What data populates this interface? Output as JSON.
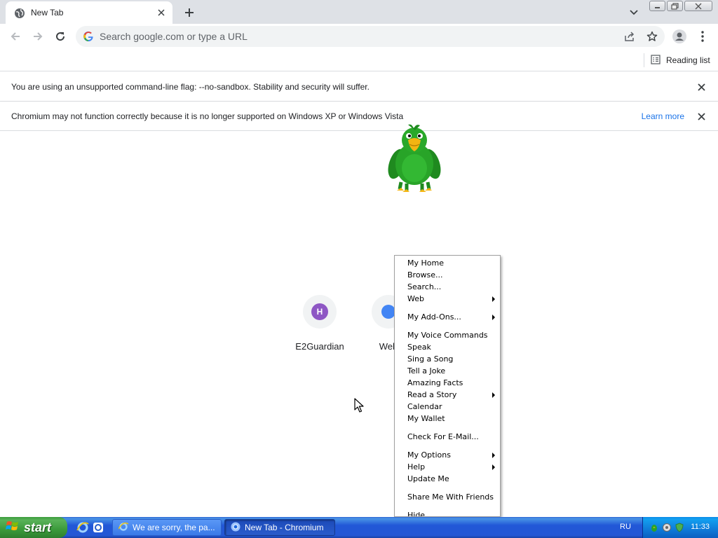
{
  "browser": {
    "tab": {
      "title": "New Tab",
      "close_glyph": "×"
    },
    "newtab_glyph": "+",
    "omnibox": {
      "placeholder": "Search google.com or type a URL"
    },
    "bookmarks": {
      "reading_list": "Reading list"
    },
    "infobars": [
      {
        "message": "You are using an unsupported command-line flag: --no-sandbox. Stability and security will suffer."
      },
      {
        "message": "Chromium may not function correctly because it is no longer supported on Windows XP or Windows Vista",
        "link": "Learn more"
      }
    ],
    "icons": {
      "tab_favicon": "globe-icon",
      "back": "back-arrow-icon",
      "forward": "forward-arrow-icon",
      "reload": "reload-icon",
      "share": "share-icon",
      "bookmark": "star-icon",
      "profile": "profile-icon",
      "menu": "kebab-menu-icon"
    }
  },
  "newtab": {
    "shortcuts": [
      {
        "label": "E2Guardian",
        "initial": "H"
      },
      {
        "label": "Web"
      }
    ]
  },
  "context_menu": {
    "items": [
      {
        "label": "My Home",
        "submenu": false
      },
      {
        "label": "Browse...",
        "submenu": false
      },
      {
        "label": "Search...",
        "submenu": false
      },
      {
        "label": "Web",
        "submenu": true
      },
      {
        "sep": true
      },
      {
        "label": "My Add-Ons...",
        "submenu": true
      },
      {
        "sep": true
      },
      {
        "label": "My Voice Commands",
        "submenu": false
      },
      {
        "label": "Speak",
        "submenu": false
      },
      {
        "label": "Sing a Song",
        "submenu": false
      },
      {
        "label": "Tell a Joke",
        "submenu": false
      },
      {
        "label": "Amazing Facts",
        "submenu": false
      },
      {
        "label": "Read a Story",
        "submenu": true
      },
      {
        "label": "Calendar",
        "submenu": false
      },
      {
        "label": "My Wallet",
        "submenu": false
      },
      {
        "sep": true
      },
      {
        "label": "Check For E-Mail...",
        "submenu": false
      },
      {
        "sep": true
      },
      {
        "label": "My Options",
        "submenu": true
      },
      {
        "label": "Help",
        "submenu": true
      },
      {
        "label": "Update Me",
        "submenu": false
      },
      {
        "sep": true
      },
      {
        "label": "Share Me With Friends",
        "submenu": false
      },
      {
        "sep": true
      },
      {
        "label": "Hide",
        "submenu": false
      }
    ]
  },
  "taskbar": {
    "start_label": "start",
    "tasks": [
      {
        "label": "We are sorry, the pa...",
        "active": false
      },
      {
        "label": "New Tab - Chromium",
        "active": true
      }
    ],
    "language": "RU",
    "clock": "11:33"
  },
  "colors": {
    "tabstrip": "#dee1e6",
    "link": "#1a73e8",
    "shortcut_avatar": "#8e57c4",
    "xp_taskbar": "#2457d5",
    "xp_start": "#3b9a3b"
  }
}
